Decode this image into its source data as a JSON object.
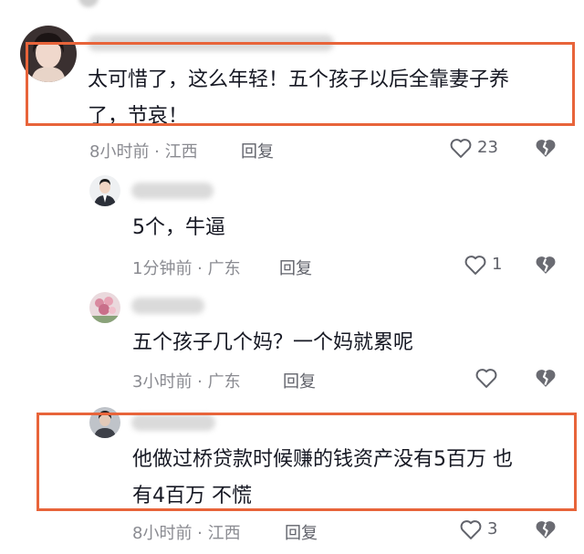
{
  "colors": {
    "highlight": "#e8643a",
    "text": "#161823",
    "meta": "#8a8b91"
  },
  "comments": [
    {
      "id": "c1",
      "text_line1": "太可惜了，这么年轻！五个孩子以后全靠妻子养",
      "text_line2": "了，节哀！",
      "time": "8小时前 · 江西",
      "reply": "回复",
      "likes": "23",
      "avatar_icon": "woman-avatar-icon"
    },
    {
      "id": "c2",
      "text_line1": "5个，牛逼",
      "time": "1分钟前 · 广东",
      "reply": "回复",
      "likes": "1",
      "avatar_icon": "man-suit-avatar-icon"
    },
    {
      "id": "c3",
      "text_line1": "五个孩子几个妈？一个妈就累呢",
      "time": "3小时前 · 广东",
      "reply": "回复",
      "likes": "",
      "avatar_icon": "flowers-avatar-icon"
    },
    {
      "id": "c4",
      "text_line1": "他做过桥贷款时候赚的钱资产没有5百万 也",
      "text_line2": "有4百万 不慌",
      "time": "8小时前 · 江西",
      "reply": "回复",
      "likes": "3",
      "avatar_icon": "person-avatar-icon"
    }
  ]
}
